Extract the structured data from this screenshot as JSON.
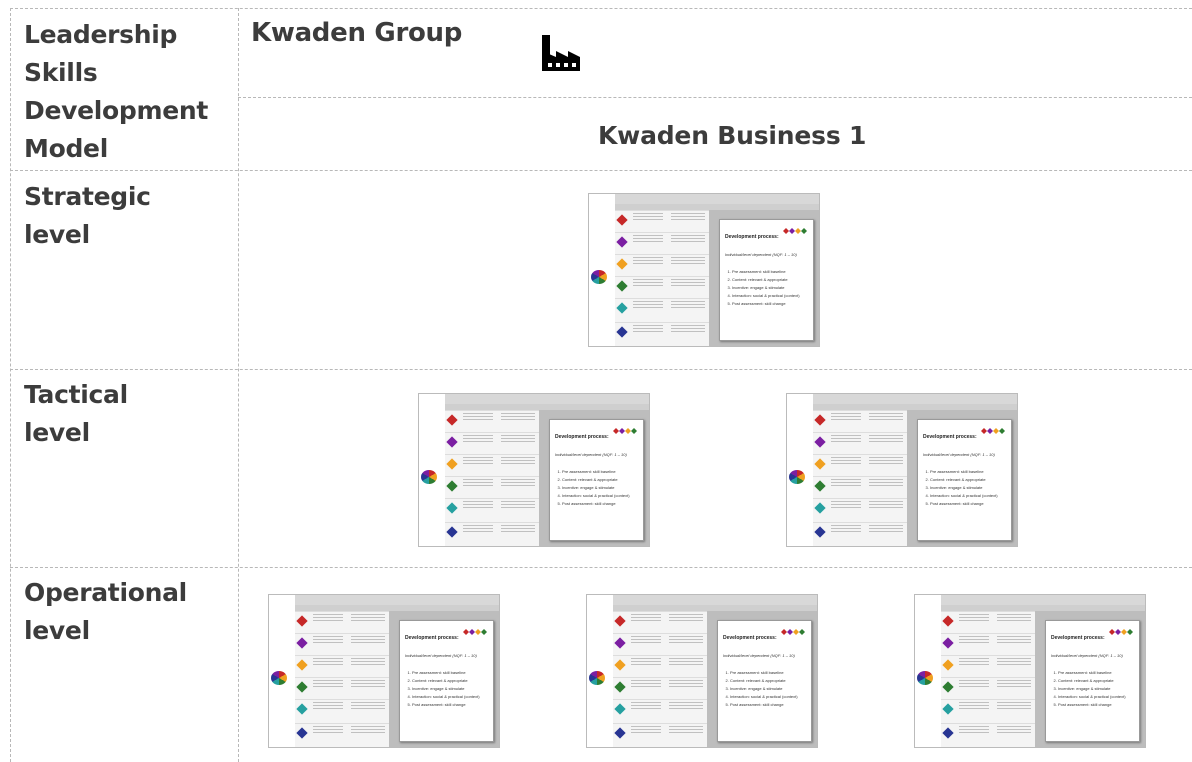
{
  "header": {
    "model_title": "Leadership Skills Development Model",
    "model_title_lines": [
      "Leadership",
      "Skills",
      "Development",
      "Model"
    ],
    "group_name": "Kwaden Group",
    "business_name": "Kwaden Business 1",
    "factory_icon": "factory-icon"
  },
  "levels": [
    {
      "label_lines": [
        "Strategic",
        "level"
      ],
      "count": 1
    },
    {
      "label_lines": [
        "Tactical",
        "level"
      ],
      "count": 2
    },
    {
      "label_lines": [
        "Operational",
        "level"
      ],
      "count": 3
    }
  ],
  "thumbnail": {
    "panel_title": "Development process:",
    "panel_subtitle": "Individual/level dependent (NQF: 1 – 10)",
    "steps": [
      "Pre assessment: skill baseline",
      "Content: relevant & appropriate",
      "Incentive: engage & stimulate",
      "Interaction: social & practical (context)",
      "Post assessment: skill change"
    ]
  }
}
